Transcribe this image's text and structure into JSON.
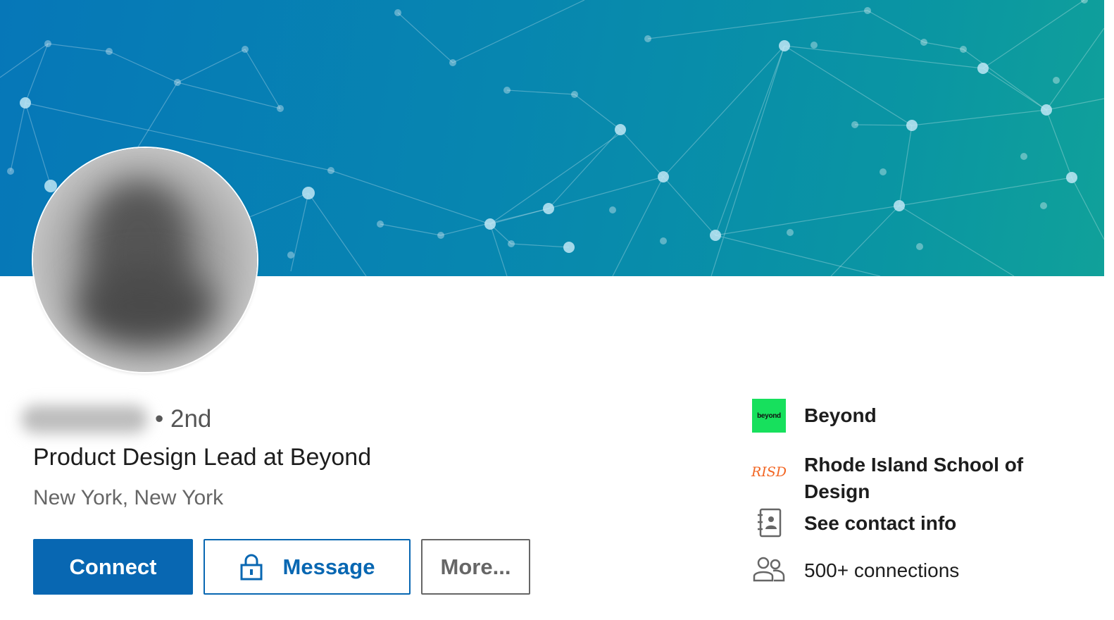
{
  "profile": {
    "degree": "• 2nd",
    "headline": "Product Design Lead at Beyond",
    "location": "New York, New York"
  },
  "actions": {
    "connect_label": "Connect",
    "message_label": "Message",
    "more_label": "More..."
  },
  "sidebar": {
    "company": {
      "name": "Beyond",
      "logo_text": "beyond"
    },
    "school": {
      "name_line1": "Rhode Island School of",
      "name_line2": "Design",
      "logo_text": "RISD"
    },
    "contact_label": "See contact info",
    "connections_label": "500+ connections"
  },
  "colors": {
    "brand_blue": "#0867b2",
    "beyond_green": "#17e05d",
    "risd_orange": "#f26522"
  },
  "icons": {
    "message": "lock-icon",
    "contact": "contact-book-icon",
    "connections": "people-icon"
  }
}
